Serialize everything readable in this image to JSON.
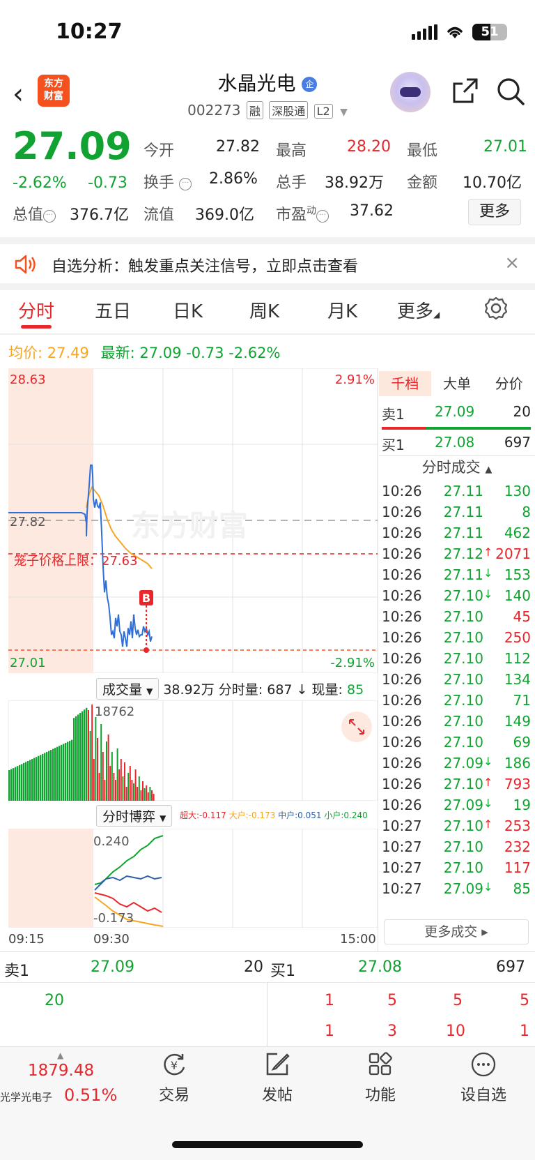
{
  "status": {
    "time": "10:27",
    "battery": "51"
  },
  "header": {
    "logo_text_1": "东方",
    "logo_text_2": "财富",
    "name": "水晶光电",
    "name_badge": "企",
    "code": "002273",
    "tags": [
      "融",
      "深股通",
      "L2"
    ]
  },
  "quote": {
    "price": "27.09",
    "change_pct": "-2.62%",
    "change": "-0.73",
    "open_label": "今开",
    "open": "27.82",
    "high_label": "最高",
    "high": "28.20",
    "low_label": "最低",
    "low": "27.01",
    "turnover_label": "换手",
    "turnover": "2.86%",
    "vol_label": "总手",
    "vol": "38.92万",
    "amount_label": "金额",
    "amount": "10.70亿",
    "mcap_label": "总值",
    "mcap": "376.7亿",
    "float_label": "流值",
    "float": "369.0亿",
    "pe_label": "市盈",
    "pe_sup": "动",
    "pe": "37.62",
    "more": "更多"
  },
  "notice": {
    "text": "自选分析：触发重点关注信号，立即点击查看",
    "close": "×"
  },
  "tabs": [
    "分时",
    "五日",
    "日K",
    "周K",
    "月K",
    "更多"
  ],
  "legend": {
    "avg_label": "均价:",
    "avg": "27.49",
    "latest_label": "最新:",
    "latest": "27.09",
    "latest_chg": "-0.73",
    "latest_pct": "-2.62%"
  },
  "chart_axes": {
    "top_price": "28.63",
    "top_pct": "2.91%",
    "ref_price": "27.82",
    "cage_label": "笼子价格上限：27.63",
    "bottom_price": "27.01",
    "bottom_pct": "-2.91%",
    "b_marker": "B",
    "watermark": "东方财富"
  },
  "volume": {
    "selector": "成交量",
    "total": "38.92万",
    "min_label": "分时量:",
    "min_vol": "687",
    "now_label": "现量:",
    "now_vol": "85",
    "max_label": "18762"
  },
  "game": {
    "selector": "分时博弈",
    "super_label": "超大:",
    "super": "-0.117",
    "large_label": "大户:",
    "large": "-0.173",
    "mid_label": "中户:",
    "mid": "0.051",
    "small_label": "小户:",
    "small": "0.240",
    "top_label": "0.240",
    "bottom_label": "-0.173"
  },
  "time_axis": [
    "09:15",
    "09:30",
    "15:00"
  ],
  "right_panel": {
    "tabs": [
      "千档",
      "大单",
      "分价"
    ],
    "sell1_label": "卖1",
    "sell1_price": "27.09",
    "sell1_vol": "20",
    "buy1_label": "买1",
    "buy1_price": "27.08",
    "buy1_vol": "697",
    "ticks_title": "分时成交",
    "more_deals": "更多成交 ▸",
    "ticks": [
      {
        "time": "10:26",
        "price": "27.11",
        "vol": "130",
        "dir": "",
        "vc": "green"
      },
      {
        "time": "10:26",
        "price": "27.11",
        "vol": "8",
        "dir": "",
        "vc": "green"
      },
      {
        "time": "10:26",
        "price": "27.11",
        "vol": "462",
        "dir": "",
        "vc": "green"
      },
      {
        "time": "10:26",
        "price": "27.12",
        "vol": "2071",
        "dir": "↑",
        "vc": "red"
      },
      {
        "time": "10:26",
        "price": "27.11",
        "vol": "153",
        "dir": "↓",
        "vc": "green"
      },
      {
        "time": "10:26",
        "price": "27.10",
        "vol": "140",
        "dir": "↓",
        "vc": "green"
      },
      {
        "time": "10:26",
        "price": "27.10",
        "vol": "45",
        "dir": "",
        "vc": "red"
      },
      {
        "time": "10:26",
        "price": "27.10",
        "vol": "250",
        "dir": "",
        "vc": "red"
      },
      {
        "time": "10:26",
        "price": "27.10",
        "vol": "112",
        "dir": "",
        "vc": "green"
      },
      {
        "time": "10:26",
        "price": "27.10",
        "vol": "134",
        "dir": "",
        "vc": "green"
      },
      {
        "time": "10:26",
        "price": "27.10",
        "vol": "71",
        "dir": "",
        "vc": "green"
      },
      {
        "time": "10:26",
        "price": "27.10",
        "vol": "149",
        "dir": "",
        "vc": "green"
      },
      {
        "time": "10:26",
        "price": "27.10",
        "vol": "69",
        "dir": "",
        "vc": "green"
      },
      {
        "time": "10:26",
        "price": "27.09",
        "vol": "186",
        "dir": "↓",
        "vc": "green"
      },
      {
        "time": "10:26",
        "price": "27.10",
        "vol": "793",
        "dir": "↑",
        "vc": "red"
      },
      {
        "time": "10:26",
        "price": "27.09",
        "vol": "19",
        "dir": "↓",
        "vc": "green"
      },
      {
        "time": "10:27",
        "price": "27.10",
        "vol": "253",
        "dir": "↑",
        "vc": "red"
      },
      {
        "time": "10:27",
        "price": "27.10",
        "vol": "232",
        "dir": "",
        "vc": "red"
      },
      {
        "time": "10:27",
        "price": "27.10",
        "vol": "117",
        "dir": "",
        "vc": "red"
      },
      {
        "time": "10:27",
        "price": "27.09",
        "vol": "85",
        "dir": "↓",
        "vc": "green"
      }
    ]
  },
  "order_book": {
    "sell_label": "卖1",
    "sell_price": "27.09",
    "sell_vol": "20",
    "buy_label": "买1",
    "buy_price": "27.08",
    "buy_vol": "697",
    "sell_queue": [
      "20"
    ],
    "buy_queue_1": [
      "1",
      "5",
      "5",
      "5"
    ],
    "buy_queue_2": [
      "1",
      "3",
      "10",
      "1"
    ]
  },
  "bottom": {
    "index_value": "1879.48",
    "index_name": "光学光电子",
    "index_pct": "0.51%",
    "nav": [
      "交易",
      "发帖",
      "功能",
      "设自选"
    ]
  },
  "chart_data": {
    "type": "line",
    "ylim": [
      27.01,
      28.63
    ],
    "ref": 27.82,
    "price_series": [
      [
        0,
        27.82
      ],
      [
        25,
        27.82
      ],
      [
        45,
        27.82
      ],
      [
        60,
        27.82
      ],
      [
        75,
        27.82
      ],
      [
        90,
        27.82
      ],
      [
        105,
        27.82
      ],
      [
        110,
        27.81
      ],
      [
        112,
        27.76
      ],
      [
        112,
        27.68
      ],
      [
        113,
        27.82
      ],
      [
        114,
        27.88
      ],
      [
        116,
        27.98
      ],
      [
        118,
        28.1
      ],
      [
        120,
        28.1
      ],
      [
        121,
        28.04
      ],
      [
        122,
        27.9
      ],
      [
        124,
        27.85
      ],
      [
        126,
        27.9
      ],
      [
        128,
        27.86
      ],
      [
        130,
        27.85
      ],
      [
        132,
        27.88
      ],
      [
        134,
        27.7
      ],
      [
        136,
        27.5
      ],
      [
        138,
        27.35
      ],
      [
        140,
        27.42
      ],
      [
        142,
        27.32
      ],
      [
        144,
        27.28
      ],
      [
        146,
        27.2
      ],
      [
        148,
        27.1
      ],
      [
        150,
        27.12
      ],
      [
        152,
        27.08
      ],
      [
        154,
        27.2
      ],
      [
        156,
        27.15
      ],
      [
        158,
        27.22
      ],
      [
        160,
        27.12
      ],
      [
        162,
        27.1
      ],
      [
        164,
        27.03
      ],
      [
        166,
        27.12
      ],
      [
        168,
        27.08
      ],
      [
        170,
        27.03
      ],
      [
        172,
        27.14
      ],
      [
        174,
        27.1
      ],
      [
        176,
        27.18
      ],
      [
        178,
        27.08
      ],
      [
        180,
        27.22
      ],
      [
        182,
        27.14
      ],
      [
        184,
        27.1
      ],
      [
        186,
        27.13
      ],
      [
        188,
        27.09
      ],
      [
        190,
        27.1
      ],
      [
        192,
        27.1
      ],
      [
        194,
        27.15
      ],
      [
        196,
        27.12
      ],
      [
        198,
        27.14
      ],
      [
        200,
        27.1
      ],
      [
        202,
        27.12
      ],
      [
        204,
        27.06
      ],
      [
        206,
        27.09
      ]
    ],
    "avg_series": [
      [
        112,
        27.85
      ],
      [
        116,
        27.93
      ],
      [
        120,
        27.97
      ],
      [
        124,
        27.95
      ],
      [
        130,
        27.92
      ],
      [
        136,
        27.86
      ],
      [
        142,
        27.78
      ],
      [
        148,
        27.72
      ],
      [
        154,
        27.68
      ],
      [
        160,
        27.65
      ],
      [
        168,
        27.61
      ],
      [
        176,
        27.58
      ],
      [
        184,
        27.56
      ],
      [
        192,
        27.54
      ],
      [
        200,
        27.52
      ],
      [
        206,
        27.49
      ]
    ]
  }
}
